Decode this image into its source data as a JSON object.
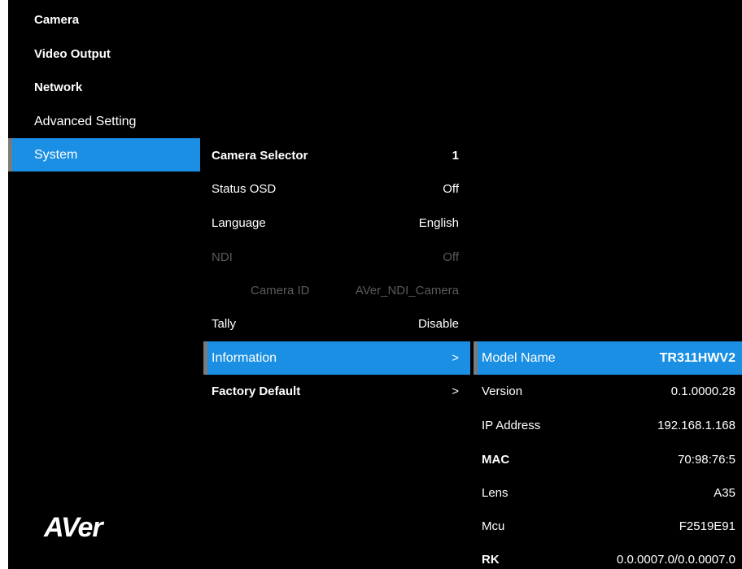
{
  "main_menu": {
    "items": [
      {
        "label": "Camera"
      },
      {
        "label": "Video Output"
      },
      {
        "label": "Network"
      },
      {
        "label": "Advanced Setting"
      },
      {
        "label": "System"
      }
    ]
  },
  "system_menu": {
    "items": [
      {
        "label": "Camera Selector",
        "value": "1"
      },
      {
        "label": "Status OSD",
        "value": "Off"
      },
      {
        "label": "Language",
        "value": "English"
      },
      {
        "label": "NDI",
        "value": "Off"
      },
      {
        "label": "Camera ID",
        "value": "AVer_NDI_Camera"
      },
      {
        "label": "Tally",
        "value": "Disable"
      },
      {
        "label": "Information",
        "value": ">"
      },
      {
        "label": "Factory Default",
        "value": ">"
      }
    ]
  },
  "information_panel": {
    "items": [
      {
        "label": "Model Name",
        "value": "TR311HWV2"
      },
      {
        "label": "Version",
        "value": "0.1.0000.28"
      },
      {
        "label": "IP Address",
        "value": "192.168.1.168"
      },
      {
        "label": "MAC",
        "value": "70:98:76:5"
      },
      {
        "label": "Lens",
        "value": "A35"
      },
      {
        "label": "Mcu",
        "value": "F2519E91"
      },
      {
        "label": "RK",
        "value": "0.0.0007.0/0.0.0007.0"
      }
    ]
  },
  "logo": {
    "text": "AVer"
  },
  "colors": {
    "background": "#000000",
    "selection": "#1a8fe3",
    "selection_marker": "#7b7b7b",
    "disabled_text": "#5a5a5a"
  }
}
